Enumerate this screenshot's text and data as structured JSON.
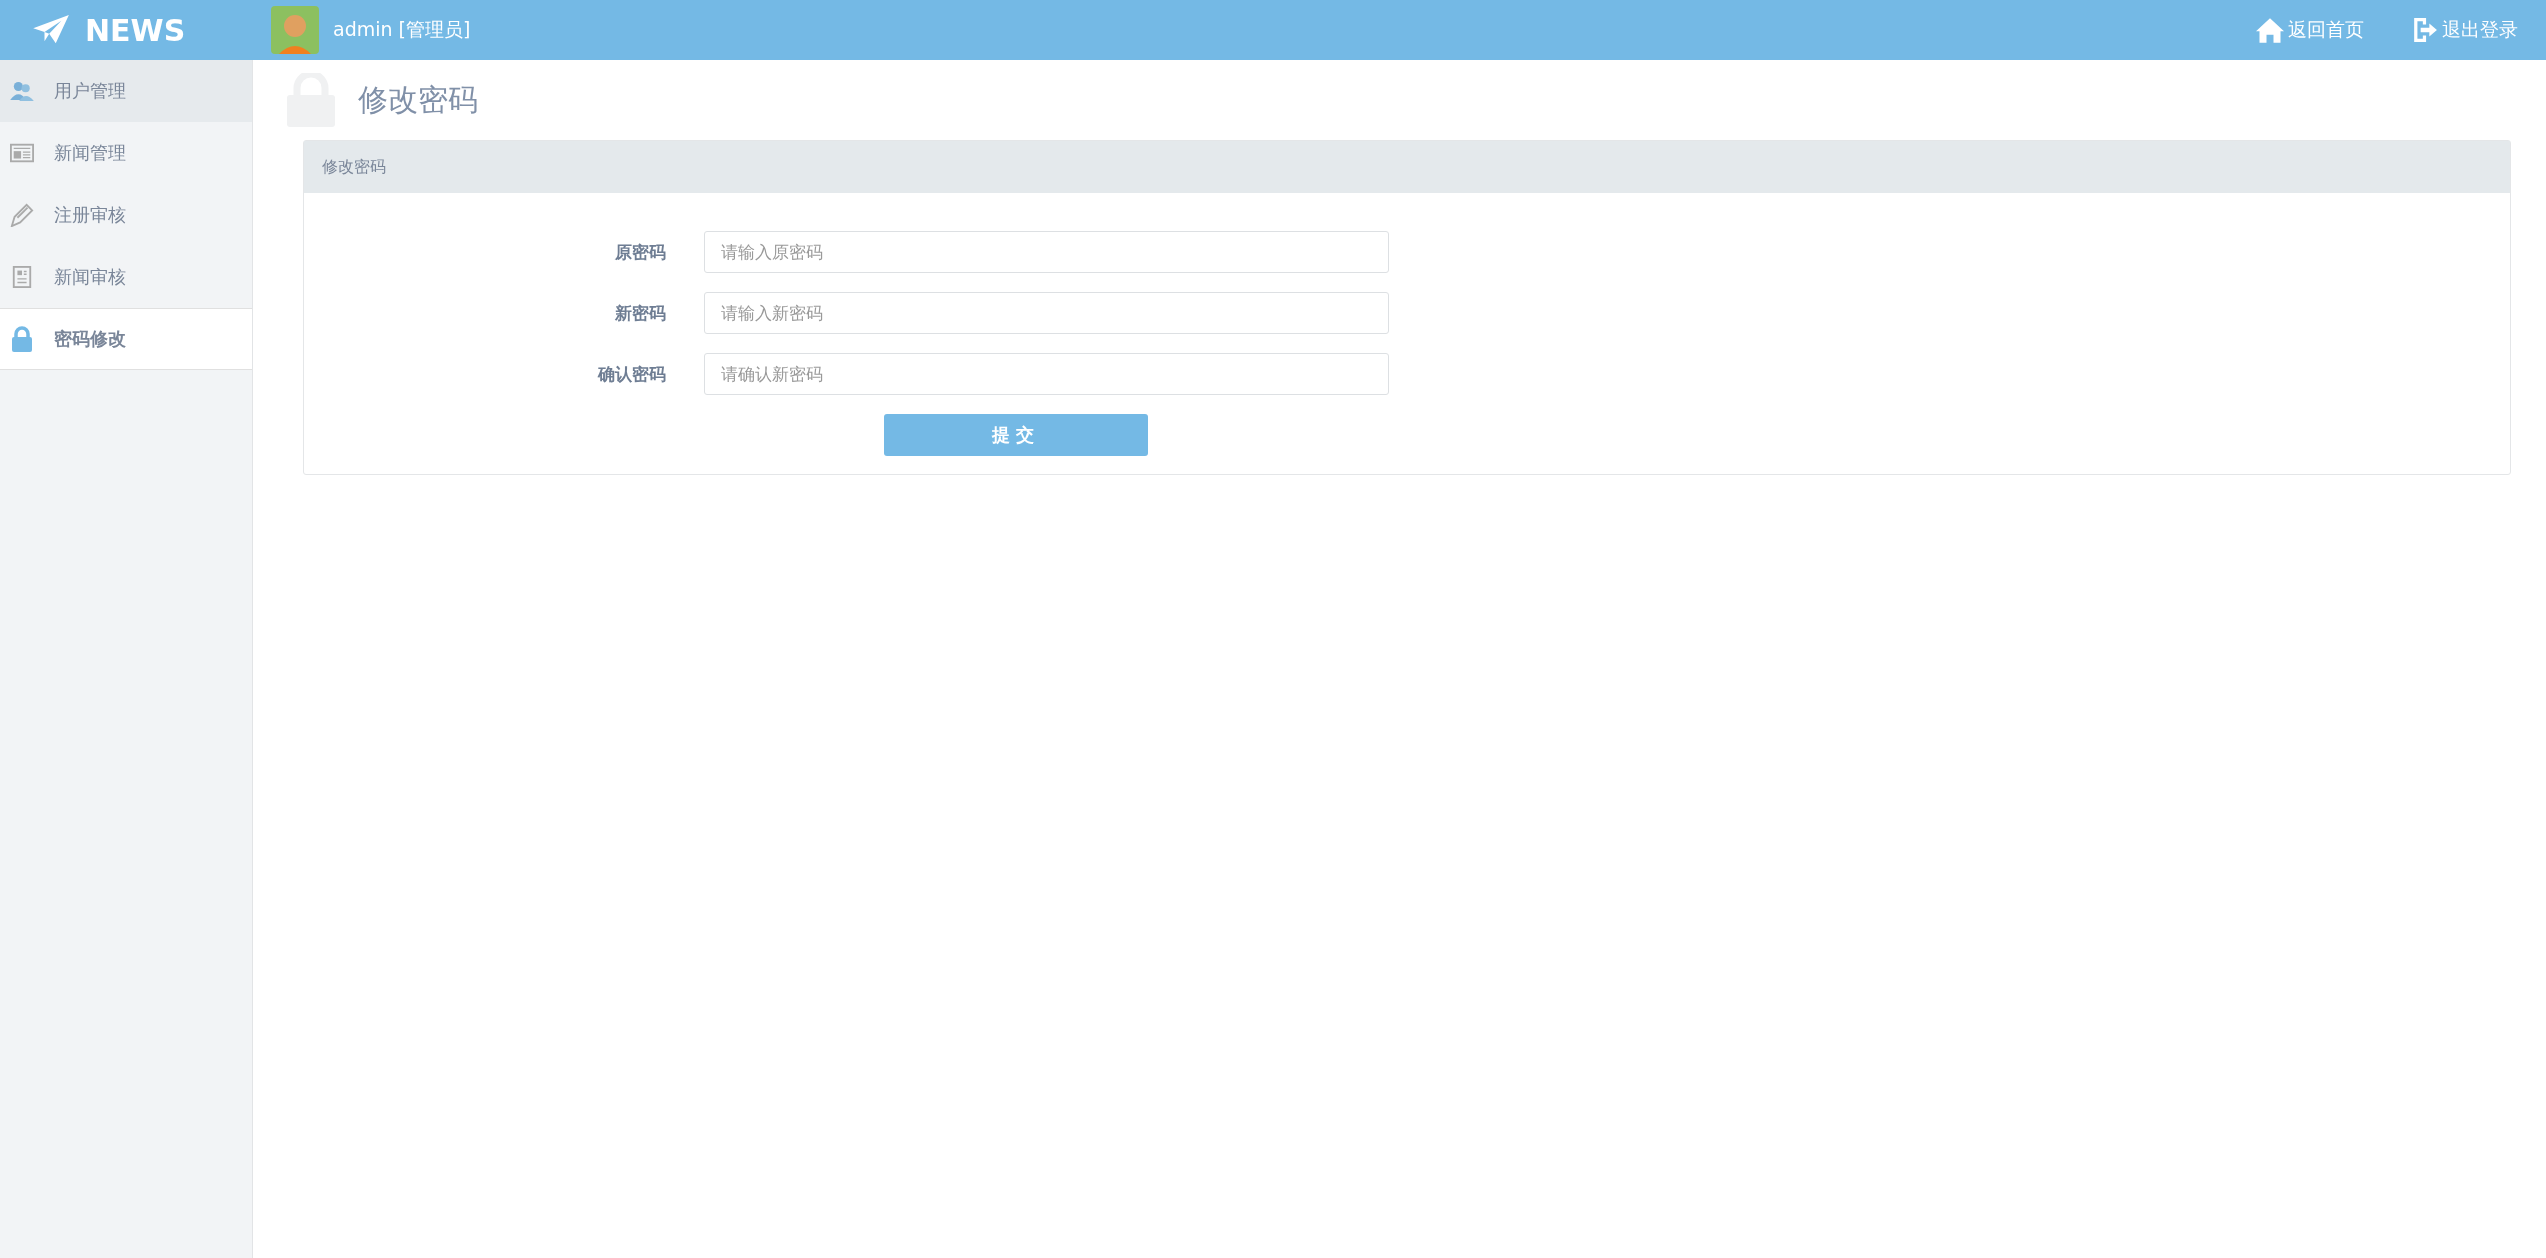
{
  "header": {
    "logo": "NEWS",
    "user": "admin [管理员]",
    "links": [
      {
        "kind": "home",
        "label": "返回首页"
      },
      {
        "kind": "logout",
        "label": "退出登录"
      }
    ]
  },
  "sidebar": {
    "items": [
      {
        "kind": "users",
        "label": "用户管理",
        "selected": false,
        "hovered": true
      },
      {
        "kind": "news",
        "label": "新闻管理",
        "selected": false,
        "hovered": false
      },
      {
        "kind": "pen",
        "label": "注册审核",
        "selected": false,
        "hovered": false
      },
      {
        "kind": "doc",
        "label": "新闻审核",
        "selected": false,
        "hovered": false
      },
      {
        "kind": "lock",
        "label": "密码修改",
        "selected": true,
        "hovered": false
      }
    ]
  },
  "page": {
    "title": "修改密码"
  },
  "panel": {
    "title": "修改密码",
    "fields": [
      {
        "label": "原密码",
        "placeholder": "请输入原密码"
      },
      {
        "label": "新密码",
        "placeholder": "请输入新密码"
      },
      {
        "label": "确认密码",
        "placeholder": "请确认新密码"
      }
    ],
    "submit": "提交"
  }
}
